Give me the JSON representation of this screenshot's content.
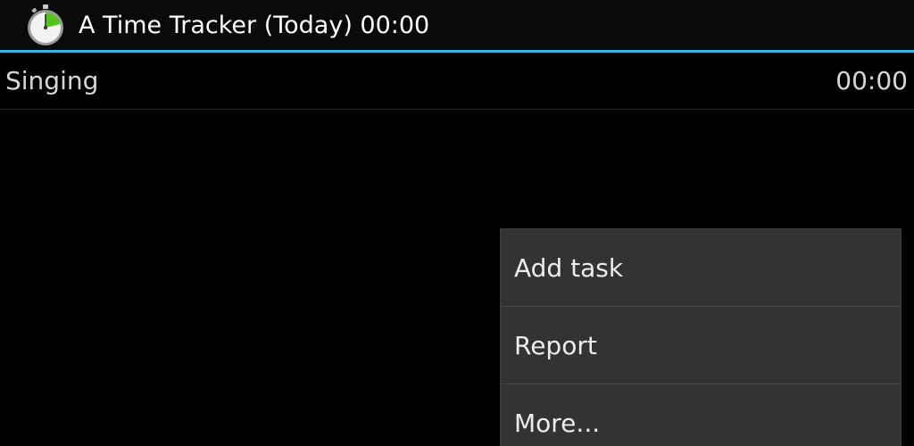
{
  "action_bar": {
    "title": "A Time Tracker (Today) 00:00",
    "icon": "stopwatch-icon",
    "accent_color": "#33b5e5"
  },
  "tasks": [
    {
      "name": "Singing",
      "time": "00:00"
    }
  ],
  "overflow_menu": {
    "items": [
      {
        "label": "Add task"
      },
      {
        "label": "Report"
      },
      {
        "label": "More..."
      }
    ]
  }
}
